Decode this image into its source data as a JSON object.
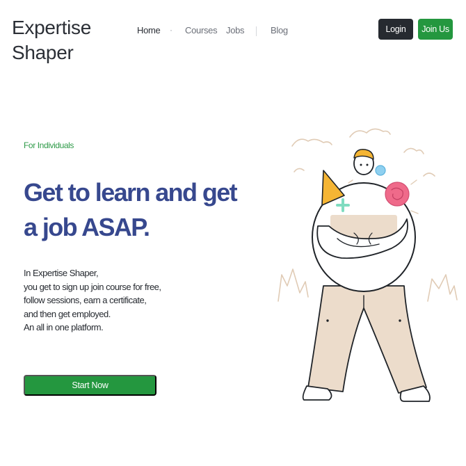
{
  "brand": {
    "line1": "Expertise",
    "line2": "Shaper"
  },
  "nav": {
    "items": [
      {
        "label": "Home"
      },
      {
        "label": "Courses"
      },
      {
        "label": "Jobs"
      },
      {
        "label": "Blog"
      }
    ],
    "separator": "·"
  },
  "header": {
    "login_label": "Login",
    "join_label": "Join Us"
  },
  "hero": {
    "tag": "For Individuals",
    "headline": "Get to learn and get a job ASAP.",
    "description_lines": [
      "In Expertise Shaper,",
      "you get to sign up join course for free,",
      "follow sessions, earn a certificate,",
      "and then get employed.",
      "An all in one platform."
    ],
    "cta_label": "Start Now"
  },
  "colors": {
    "accent_green": "#24973f",
    "headline_blue": "#37488e",
    "dark_button": "#262a30",
    "illustration_beige": "#ecdccb",
    "illustration_yellow": "#f5b534",
    "illustration_pink": "#ef6a8a",
    "illustration_blue": "#8fd0f0",
    "illustration_mint": "#7fdcc0"
  }
}
